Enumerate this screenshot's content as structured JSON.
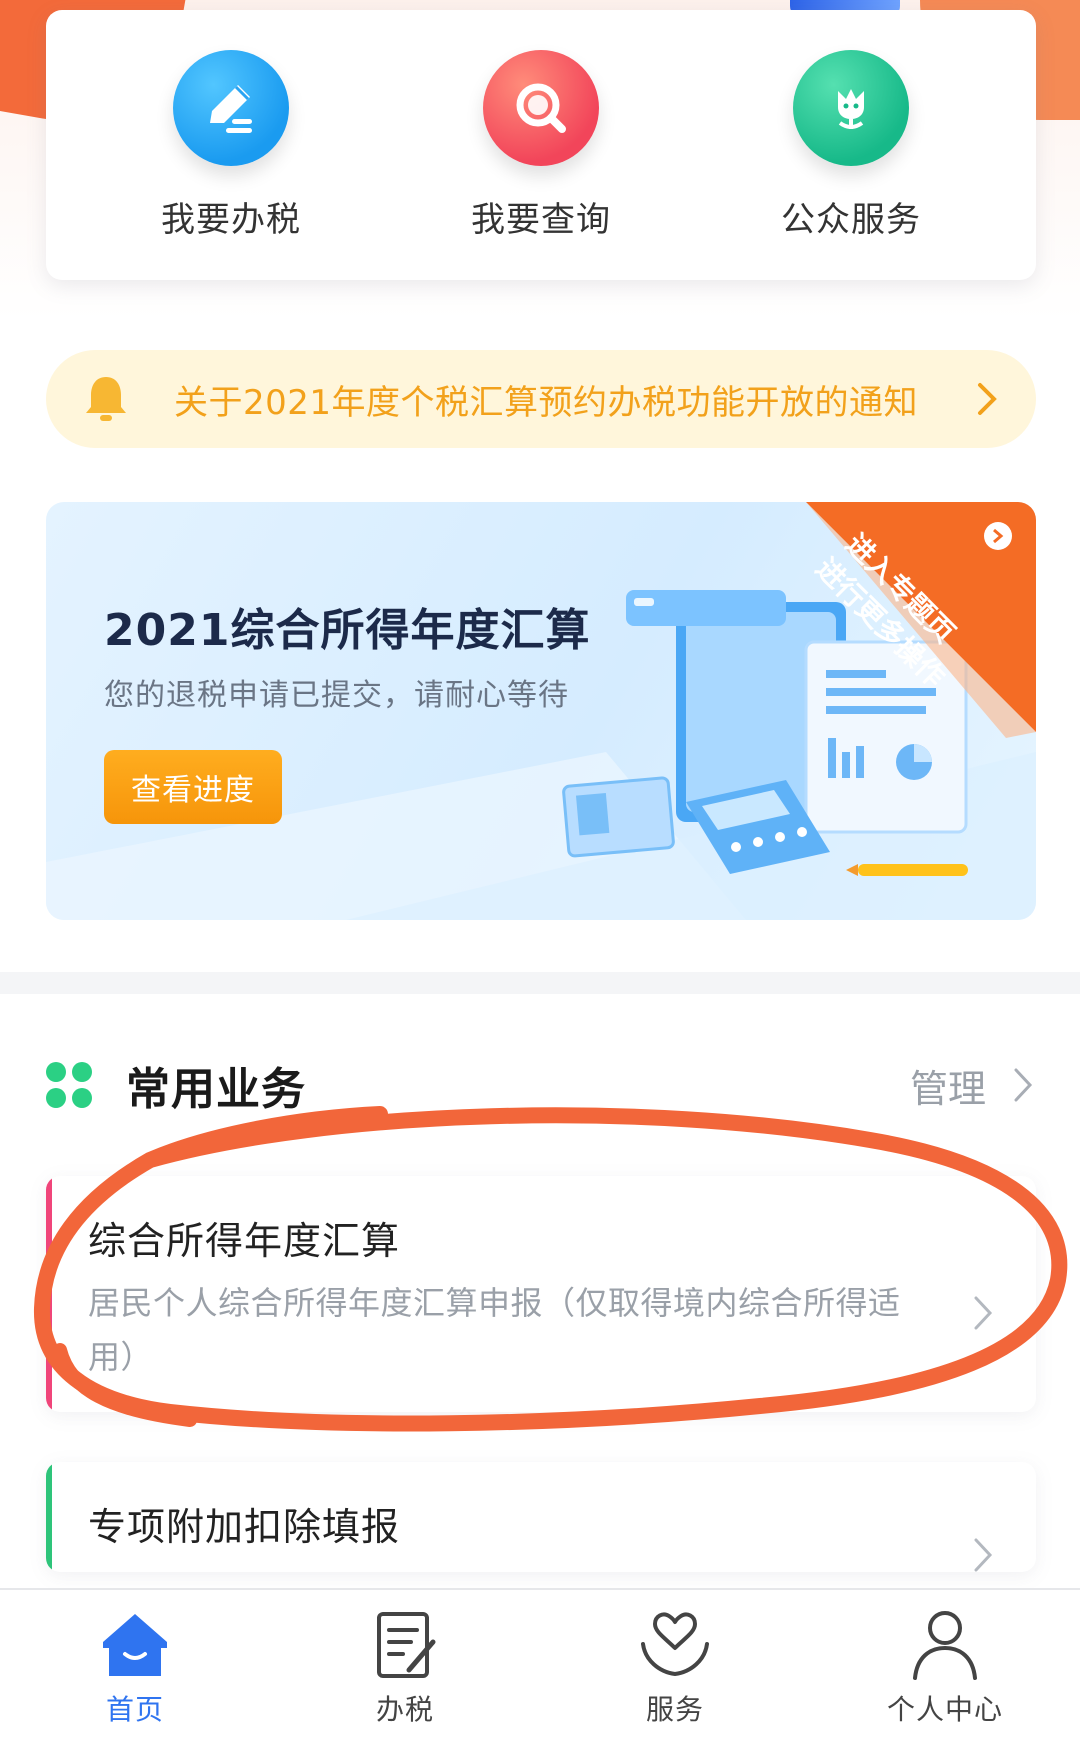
{
  "quick_actions": [
    {
      "label": "我要办税",
      "icon": "edit-icon"
    },
    {
      "label": "我要查询",
      "icon": "search-icon"
    },
    {
      "label": "公众服务",
      "icon": "service-icon"
    }
  ],
  "notice": {
    "text": "关于2021年度个税汇算预约办税功能开放的通知",
    "icon": "bell-icon"
  },
  "banner": {
    "title": "2021综合所得年度汇算",
    "subtitle": "您的退税申请已提交，请耐心等待",
    "button_label": "查看进度",
    "corner_line1": "进入专题页",
    "corner_line2": "进行更多操作"
  },
  "common_services": {
    "title": "常用业务",
    "manage_label": "管理",
    "items": [
      {
        "title": "综合所得年度汇算",
        "description": "居民个人综合所得年度汇算申报（仅取得境内综合所得适用）",
        "accent": "#f0457a"
      },
      {
        "title": "专项附加扣除填报",
        "description": "",
        "accent": "#2ec47a"
      }
    ]
  },
  "bottom_nav": [
    {
      "label": "首页",
      "icon": "home-icon",
      "active": true
    },
    {
      "label": "办税",
      "icon": "tax-form-icon",
      "active": false
    },
    {
      "label": "服务",
      "icon": "heart-hand-icon",
      "active": false
    },
    {
      "label": "个人中心",
      "icon": "user-icon",
      "active": false
    }
  ],
  "colors": {
    "primary_blue": "#2f74f0",
    "notice_orange": "#f2a11b",
    "annotation_orange": "#f2663a",
    "button_orange": "#f6950a"
  }
}
